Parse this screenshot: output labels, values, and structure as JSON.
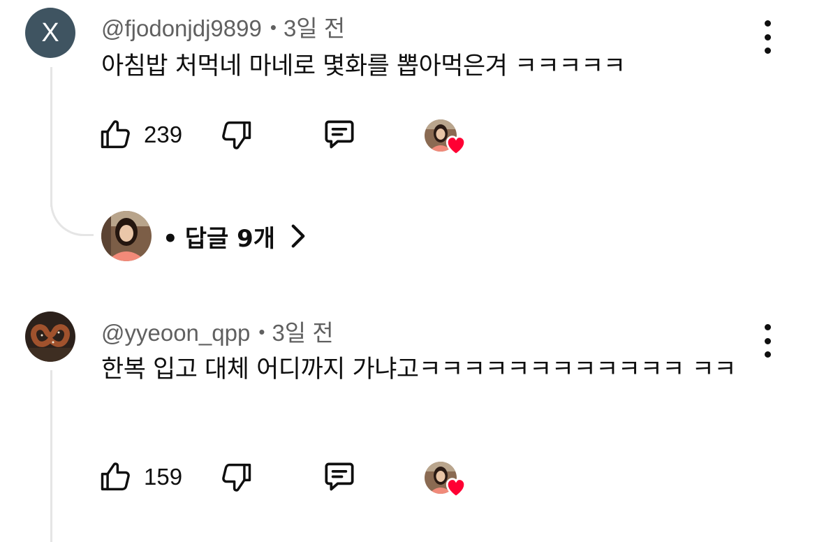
{
  "comments": [
    {
      "avatar_letter": "X",
      "avatar_color": "#3f5461",
      "username": "@fjodonjdj9899",
      "separator": "•",
      "time": "3일 전",
      "text": "아침밥 처먹네 마네로 몇화를 뽑아먹은겨 ㅋㅋㅋㅋㅋ",
      "likes": "239",
      "creator_heart": true,
      "replies": {
        "bullet": "•",
        "label": "답글 9개"
      }
    },
    {
      "avatar_letter": "",
      "username": "@yyeoon_qpp",
      "separator": "•",
      "time": "3일 전",
      "text": "한복 입고 대체 어디까지 가냐고ㅋㅋㅋㅋㅋㅋㅋㅋㅋㅋㅋㅋ ㅋㅋ",
      "likes": "159",
      "creator_heart": true
    }
  ],
  "icons": {
    "like": "thumbs-up-icon",
    "dislike": "thumbs-down-icon",
    "reply": "comment-icon",
    "menu": "more-vertical-icon",
    "heart": "heart-icon",
    "chevron": "chevron-right-icon"
  },
  "colors": {
    "heart": "#ff0033",
    "meta_text": "#606060",
    "thread_line": "#e5e5e5"
  }
}
